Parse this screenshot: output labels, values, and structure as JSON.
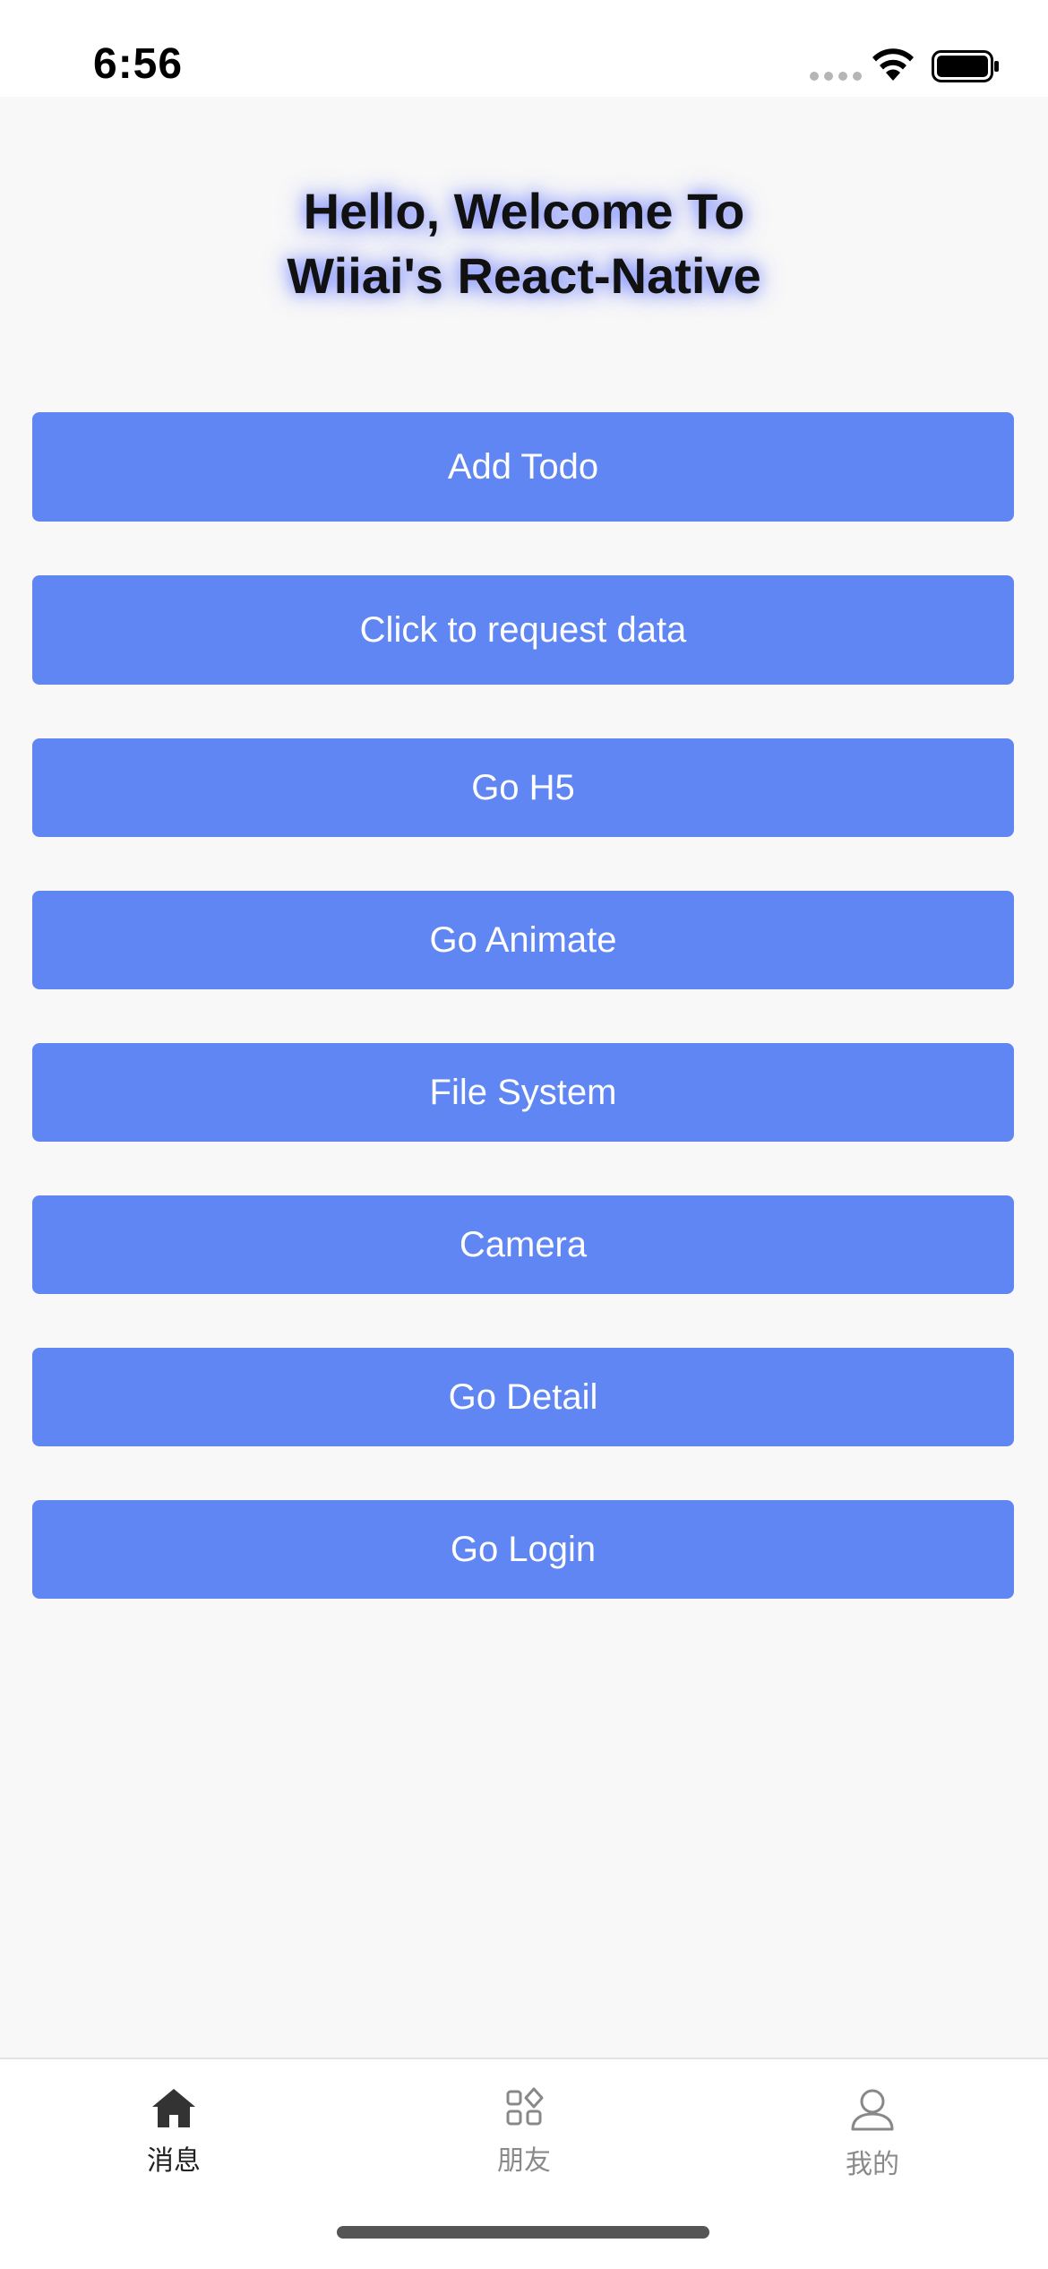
{
  "status_bar": {
    "time": "6:56"
  },
  "header": {
    "title_line1": "Hello, Welcome To",
    "title_line2": "Wiiai's React-Native",
    "title_glow_color": "#5a6eff"
  },
  "buttons": [
    {
      "label": "Add Todo"
    },
    {
      "label": "Click to request data"
    },
    {
      "label": "Go H5"
    },
    {
      "label": "Go Animate"
    },
    {
      "label": "File System"
    },
    {
      "label": "Camera"
    },
    {
      "label": "Go Detail"
    },
    {
      "label": "Go Login"
    }
  ],
  "theme": {
    "button_color": "#5f86f3",
    "button_text_color": "#ffffff",
    "background": "#f8f8f8"
  },
  "tab_bar": {
    "tabs": [
      {
        "label": "消息",
        "icon": "home-icon",
        "active": true
      },
      {
        "label": "朋友",
        "icon": "grid-icon",
        "active": false
      },
      {
        "label": "我的",
        "icon": "user-icon",
        "active": false
      }
    ]
  }
}
